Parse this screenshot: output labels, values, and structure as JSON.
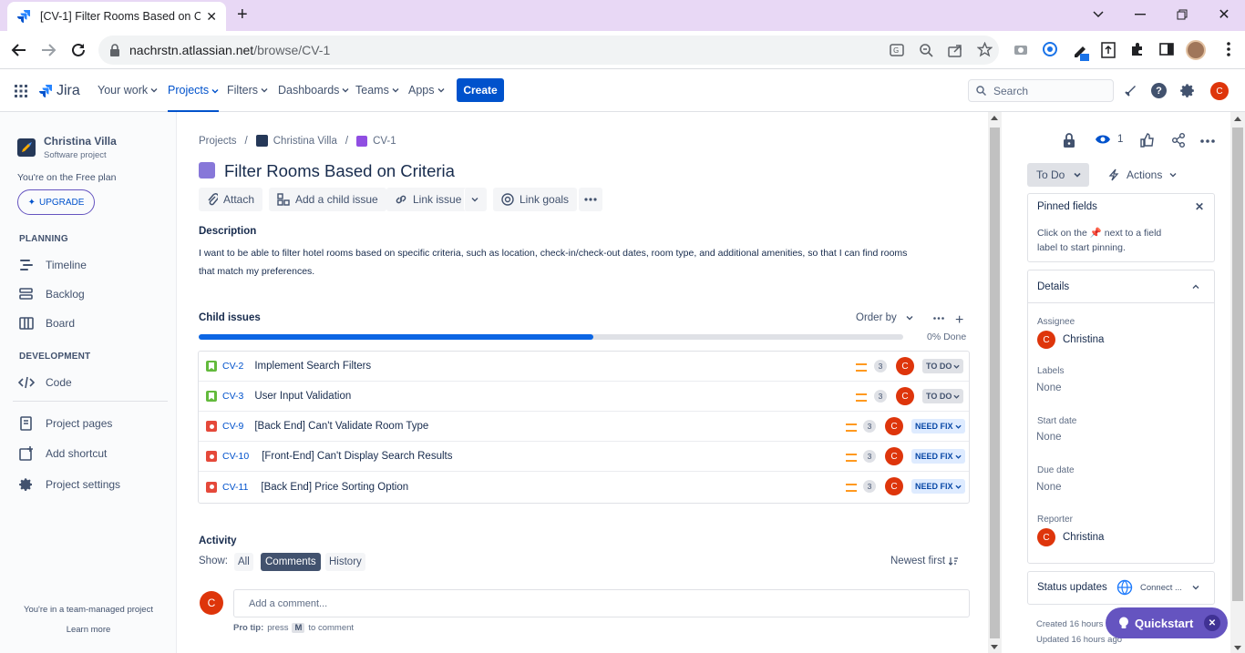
{
  "browser": {
    "tab_title": "[CV-1] Filter Rooms Based on Criteria",
    "url_host": "nachrstn.atlassian.net",
    "url_path": "/browse/CV-1"
  },
  "nav": {
    "logo": "Jira",
    "items": [
      "Your work",
      "Projects",
      "Filters",
      "Dashboards",
      "Teams",
      "Apps"
    ],
    "create": "Create",
    "search_placeholder": "Search",
    "avatar_letter": "C"
  },
  "sidebar": {
    "project_name": "Christina Villa",
    "project_type": "Software project",
    "plan_text": "You're on the Free plan",
    "upgrade": "UPGRADE",
    "planning_header": "PLANNING",
    "planning_items": [
      "Timeline",
      "Backlog",
      "Board"
    ],
    "development_header": "DEVELOPMENT",
    "dev_items": [
      "Code"
    ],
    "other_items": [
      "Project pages",
      "Add shortcut",
      "Project settings"
    ],
    "footer": "You're in a team-managed project",
    "learn_more": "Learn more"
  },
  "breadcrumb": [
    "Projects",
    "Christina Villa",
    "CV-1"
  ],
  "issue": {
    "title": "Filter Rooms Based on Criteria",
    "actions": [
      "Attach",
      "Add a child issue",
      "Link issue",
      "Link goals"
    ],
    "description_label": "Description",
    "description_line1": "I want to be able to filter hotel rooms based on specific criteria, such as location, check-in/check-out dates, room type, and additional amenities, so that I can find rooms",
    "description_line2": "that match my preferences."
  },
  "child_issues": {
    "header": "Child issues",
    "order_by": "Order by",
    "progress_label": "0% Done",
    "progress_fraction": 0.56,
    "rows": [
      {
        "type": "story",
        "key": "CV-2",
        "summary": "Implement Search Filters",
        "points": "3",
        "avatar": "C",
        "status": "TO DO"
      },
      {
        "type": "story",
        "key": "CV-3",
        "summary": "User Input Validation",
        "points": "3",
        "avatar": "C",
        "status": "TO DO"
      },
      {
        "type": "bug",
        "key": "CV-9",
        "summary": "[Back End] Can't Validate Room Type",
        "points": "3",
        "avatar": "C",
        "status": "NEED FIX"
      },
      {
        "type": "bug",
        "key": "CV-10",
        "summary": "[Front-End] Can't Display Search Results",
        "points": "3",
        "avatar": "C",
        "status": "NEED FIX"
      },
      {
        "type": "bug",
        "key": "CV-11",
        "summary": "[Back End] Price Sorting Option",
        "points": "3",
        "avatar": "C",
        "status": "NEED FIX"
      }
    ]
  },
  "activity": {
    "header": "Activity",
    "show_label": "Show:",
    "filters": [
      "All",
      "Comments",
      "History"
    ],
    "active_filter": "Comments",
    "sort": "Newest first",
    "comment_placeholder": "Add a comment...",
    "protip_prefix": "Pro tip:",
    "protip_mid": "press",
    "protip_key": "M",
    "protip_suffix": "to comment",
    "avatar_letter": "C"
  },
  "right_panel": {
    "watch_count": "1",
    "status_button": "To Do",
    "actions_button": "Actions",
    "pinned_title": "Pinned fields",
    "pinned_text_a": "Click on the",
    "pinned_text_b": "next to a field",
    "pinned_text_c": "label to start pinning.",
    "details_title": "Details",
    "assignee_label": "Assignee",
    "assignee": "Christina",
    "labels_label": "Labels",
    "labels_value": "None",
    "start_label": "Start date",
    "start_value": "None",
    "due_label": "Due date",
    "due_value": "None",
    "reporter_label": "Reporter",
    "reporter": "Christina",
    "status_updates": "Status updates",
    "connect": "Connect ...",
    "created": "Created 16 hours a",
    "updated": "Updated 16 hours ago"
  },
  "quickstart": "Quickstart",
  "colors": {
    "brand": "#0052cc",
    "bug": "#e5493a",
    "story": "#63ba3c",
    "epic": "#8777d9",
    "avatar": "#de350b"
  }
}
